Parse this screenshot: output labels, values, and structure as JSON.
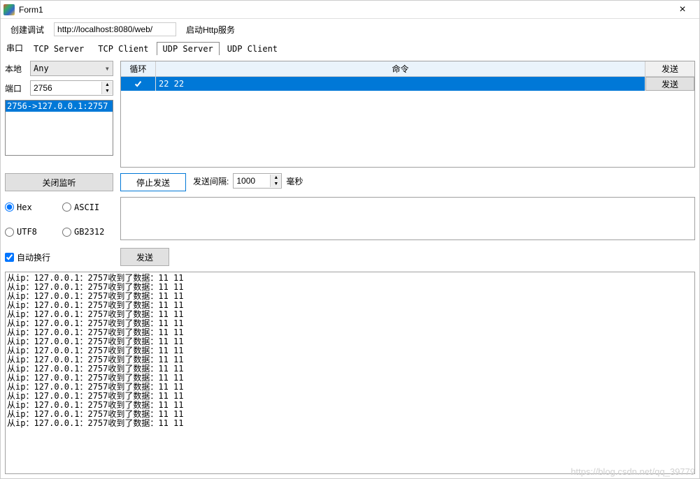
{
  "window": {
    "title": "Form1"
  },
  "toolbar": {
    "create_debug": "创建调试",
    "url_value": "http://localhost:8080/web/",
    "start_http": "启动Http服务"
  },
  "tabs": {
    "lead": "串口",
    "items": [
      "TCP Server",
      "TCP Client",
      "UDP Server",
      "UDP Client"
    ],
    "active_index": 2
  },
  "left": {
    "local_label": "本地",
    "local_value": "Any",
    "port_label": "端口",
    "port_value": "2756",
    "list_item": "2756->127.0.0.1:2757",
    "close_listen": "关闭监听"
  },
  "grid": {
    "headers": {
      "loop": "循环",
      "cmd": "命令",
      "send": "发送"
    },
    "row": {
      "checked": true,
      "cmd": "22 22",
      "send_label": "发送"
    }
  },
  "mid": {
    "stop_send": "停止发送",
    "interval_label": "发送间隔:",
    "interval_value": "1000",
    "interval_unit": "毫秒"
  },
  "radios": {
    "hex": "Hex",
    "ascii": "ASCII",
    "utf8": "UTF8",
    "gb2312": "GB2312",
    "selected": "hex"
  },
  "auto_wrap": {
    "label": "自动换行",
    "checked": true
  },
  "send_btn": "发送",
  "log_line": "从ip：127.0.0.1：2757收到了数据：11 11",
  "log_count": 17,
  "watermark": "https://blog.csdn.net/qq_39779"
}
